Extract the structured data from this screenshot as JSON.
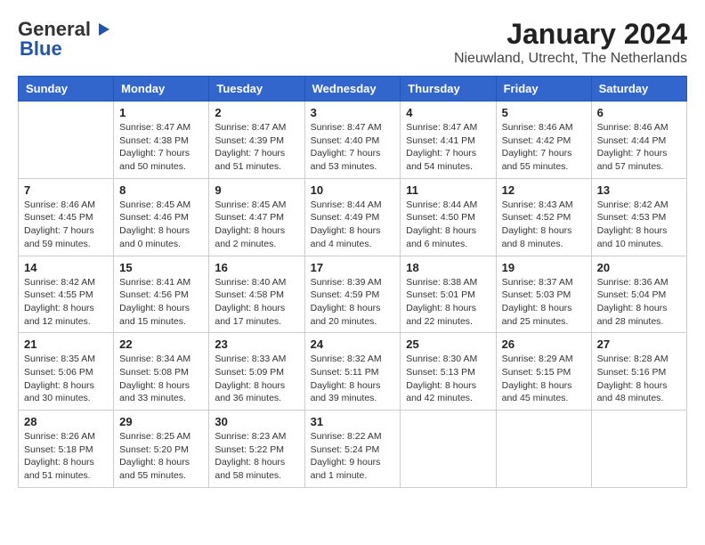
{
  "header": {
    "logo_general": "General",
    "logo_blue": "Blue",
    "month": "January 2024",
    "location": "Nieuwland, Utrecht, The Netherlands"
  },
  "weekdays": [
    "Sunday",
    "Monday",
    "Tuesday",
    "Wednesday",
    "Thursday",
    "Friday",
    "Saturday"
  ],
  "weeks": [
    [
      {
        "day": "",
        "info": ""
      },
      {
        "day": "1",
        "info": "Sunrise: 8:47 AM\nSunset: 4:38 PM\nDaylight: 7 hours\nand 50 minutes."
      },
      {
        "day": "2",
        "info": "Sunrise: 8:47 AM\nSunset: 4:39 PM\nDaylight: 7 hours\nand 51 minutes."
      },
      {
        "day": "3",
        "info": "Sunrise: 8:47 AM\nSunset: 4:40 PM\nDaylight: 7 hours\nand 53 minutes."
      },
      {
        "day": "4",
        "info": "Sunrise: 8:47 AM\nSunset: 4:41 PM\nDaylight: 7 hours\nand 54 minutes."
      },
      {
        "day": "5",
        "info": "Sunrise: 8:46 AM\nSunset: 4:42 PM\nDaylight: 7 hours\nand 55 minutes."
      },
      {
        "day": "6",
        "info": "Sunrise: 8:46 AM\nSunset: 4:44 PM\nDaylight: 7 hours\nand 57 minutes."
      }
    ],
    [
      {
        "day": "7",
        "info": "Sunrise: 8:46 AM\nSunset: 4:45 PM\nDaylight: 7 hours\nand 59 minutes."
      },
      {
        "day": "8",
        "info": "Sunrise: 8:45 AM\nSunset: 4:46 PM\nDaylight: 8 hours\nand 0 minutes."
      },
      {
        "day": "9",
        "info": "Sunrise: 8:45 AM\nSunset: 4:47 PM\nDaylight: 8 hours\nand 2 minutes."
      },
      {
        "day": "10",
        "info": "Sunrise: 8:44 AM\nSunset: 4:49 PM\nDaylight: 8 hours\nand 4 minutes."
      },
      {
        "day": "11",
        "info": "Sunrise: 8:44 AM\nSunset: 4:50 PM\nDaylight: 8 hours\nand 6 minutes."
      },
      {
        "day": "12",
        "info": "Sunrise: 8:43 AM\nSunset: 4:52 PM\nDaylight: 8 hours\nand 8 minutes."
      },
      {
        "day": "13",
        "info": "Sunrise: 8:42 AM\nSunset: 4:53 PM\nDaylight: 8 hours\nand 10 minutes."
      }
    ],
    [
      {
        "day": "14",
        "info": "Sunrise: 8:42 AM\nSunset: 4:55 PM\nDaylight: 8 hours\nand 12 minutes."
      },
      {
        "day": "15",
        "info": "Sunrise: 8:41 AM\nSunset: 4:56 PM\nDaylight: 8 hours\nand 15 minutes."
      },
      {
        "day": "16",
        "info": "Sunrise: 8:40 AM\nSunset: 4:58 PM\nDaylight: 8 hours\nand 17 minutes."
      },
      {
        "day": "17",
        "info": "Sunrise: 8:39 AM\nSunset: 4:59 PM\nDaylight: 8 hours\nand 20 minutes."
      },
      {
        "day": "18",
        "info": "Sunrise: 8:38 AM\nSunset: 5:01 PM\nDaylight: 8 hours\nand 22 minutes."
      },
      {
        "day": "19",
        "info": "Sunrise: 8:37 AM\nSunset: 5:03 PM\nDaylight: 8 hours\nand 25 minutes."
      },
      {
        "day": "20",
        "info": "Sunrise: 8:36 AM\nSunset: 5:04 PM\nDaylight: 8 hours\nand 28 minutes."
      }
    ],
    [
      {
        "day": "21",
        "info": "Sunrise: 8:35 AM\nSunset: 5:06 PM\nDaylight: 8 hours\nand 30 minutes."
      },
      {
        "day": "22",
        "info": "Sunrise: 8:34 AM\nSunset: 5:08 PM\nDaylight: 8 hours\nand 33 minutes."
      },
      {
        "day": "23",
        "info": "Sunrise: 8:33 AM\nSunset: 5:09 PM\nDaylight: 8 hours\nand 36 minutes."
      },
      {
        "day": "24",
        "info": "Sunrise: 8:32 AM\nSunset: 5:11 PM\nDaylight: 8 hours\nand 39 minutes."
      },
      {
        "day": "25",
        "info": "Sunrise: 8:30 AM\nSunset: 5:13 PM\nDaylight: 8 hours\nand 42 minutes."
      },
      {
        "day": "26",
        "info": "Sunrise: 8:29 AM\nSunset: 5:15 PM\nDaylight: 8 hours\nand 45 minutes."
      },
      {
        "day": "27",
        "info": "Sunrise: 8:28 AM\nSunset: 5:16 PM\nDaylight: 8 hours\nand 48 minutes."
      }
    ],
    [
      {
        "day": "28",
        "info": "Sunrise: 8:26 AM\nSunset: 5:18 PM\nDaylight: 8 hours\nand 51 minutes."
      },
      {
        "day": "29",
        "info": "Sunrise: 8:25 AM\nSunset: 5:20 PM\nDaylight: 8 hours\nand 55 minutes."
      },
      {
        "day": "30",
        "info": "Sunrise: 8:23 AM\nSunset: 5:22 PM\nDaylight: 8 hours\nand 58 minutes."
      },
      {
        "day": "31",
        "info": "Sunrise: 8:22 AM\nSunset: 5:24 PM\nDaylight: 9 hours\nand 1 minute."
      },
      {
        "day": "",
        "info": ""
      },
      {
        "day": "",
        "info": ""
      },
      {
        "day": "",
        "info": ""
      }
    ]
  ]
}
